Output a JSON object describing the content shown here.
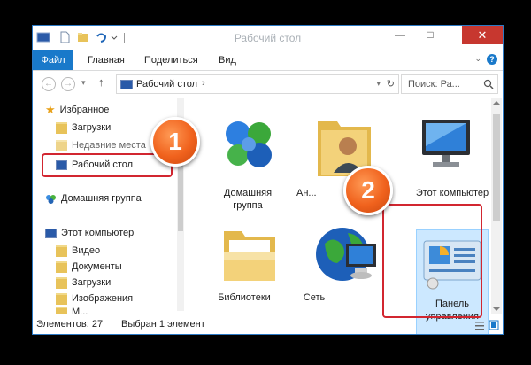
{
  "window": {
    "title": "Рабочий стол",
    "close_label": "✕",
    "minimize_label": "—",
    "maximize_label": "□"
  },
  "ribbon": {
    "tabs": [
      "Файл",
      "Главная",
      "Поделиться",
      "Вид"
    ],
    "expand_glyph": "⌄",
    "help_glyph": "?"
  },
  "nav": {
    "back_glyph": "←",
    "forward_glyph": "→",
    "recent_glyph": "▾",
    "up_glyph": "↑",
    "address_path": "Рабочий стол",
    "address_chevron": "›",
    "address_dropdown": "▾",
    "refresh_glyph": "↻",
    "search_placeholder": "Поиск: Ра..."
  },
  "sidebar": {
    "favorites": "Избранное",
    "downloads": "Загрузки",
    "recent_places": "Недавние места",
    "desktop": "Рабочий стол",
    "homegroup": "Домашняя группа",
    "this_pc": "Этот компьютер",
    "video": "Видео",
    "documents": "Документы",
    "downloads2": "Загрузки",
    "images": "Изображения",
    "music": "М..."
  },
  "items": [
    {
      "label_line1": "Домашняя",
      "label_line2": "группа"
    },
    {
      "label_line1": "Ан..."
    },
    {
      "label_line1": "Этот компьютер"
    },
    {
      "label_line1": "Библиотеки"
    },
    {
      "label_line1": "Сеть"
    },
    {
      "label_line1": "Панель",
      "label_line2": "управления"
    }
  ],
  "status": {
    "count": "Элементов: 27",
    "selected": "Выбран 1 элемент"
  },
  "annotations": {
    "badge1": "1",
    "badge2": "2",
    "accent": "#f0621d",
    "highlight": "#d22630"
  },
  "colors": {
    "ribbon_file": "#1979ca",
    "close": "#c7372f",
    "selection": "#cce8ff"
  }
}
